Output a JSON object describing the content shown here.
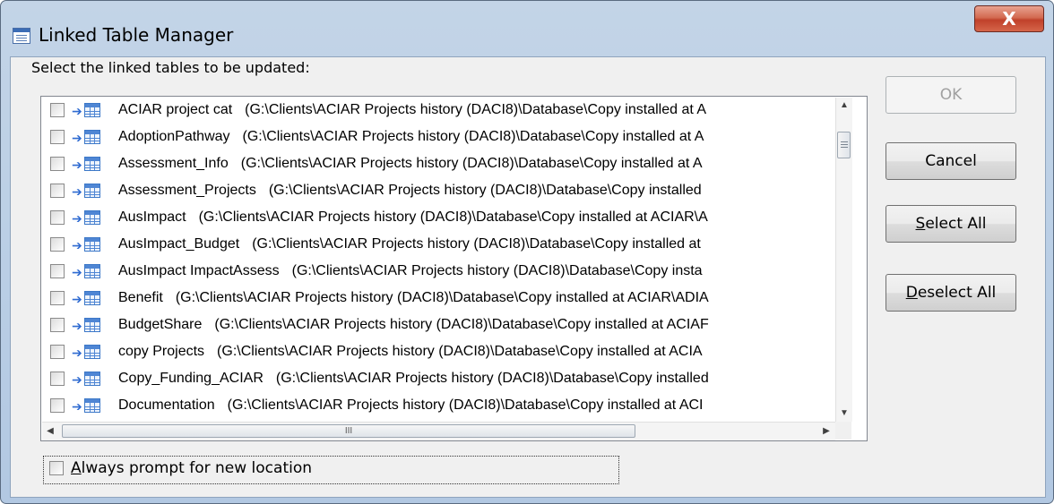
{
  "window": {
    "title": "Linked Table Manager",
    "close_glyph": "X"
  },
  "prompt": "Select the linked tables to be updated:",
  "tables": [
    {
      "name": "ACIAR project cat",
      "path": "(G:\\Clients\\ACIAR Projects history (DACI8)\\Database\\Copy installed at A"
    },
    {
      "name": "AdoptionPathway",
      "path": "(G:\\Clients\\ACIAR Projects history (DACI8)\\Database\\Copy installed at A"
    },
    {
      "name": "Assessment_Info",
      "path": "(G:\\Clients\\ACIAR Projects history (DACI8)\\Database\\Copy installed at A"
    },
    {
      "name": "Assessment_Projects",
      "path": "(G:\\Clients\\ACIAR Projects history (DACI8)\\Database\\Copy installed"
    },
    {
      "name": "AusImpact",
      "path": "(G:\\Clients\\ACIAR Projects history (DACI8)\\Database\\Copy installed at ACIAR\\A"
    },
    {
      "name": "AusImpact_Budget",
      "path": "(G:\\Clients\\ACIAR Projects history (DACI8)\\Database\\Copy installed at"
    },
    {
      "name": "AusImpact ImpactAssess",
      "path": "(G:\\Clients\\ACIAR Projects history (DACI8)\\Database\\Copy insta"
    },
    {
      "name": "Benefit",
      "path": "(G:\\Clients\\ACIAR Projects history (DACI8)\\Database\\Copy installed at ACIAR\\ADIA"
    },
    {
      "name": "BudgetShare",
      "path": "(G:\\Clients\\ACIAR Projects history (DACI8)\\Database\\Copy installed at ACIAF"
    },
    {
      "name": "copy Projects",
      "path": "(G:\\Clients\\ACIAR Projects history (DACI8)\\Database\\Copy installed at ACIA"
    },
    {
      "name": "Copy_Funding_ACIAR",
      "path": "(G:\\Clients\\ACIAR Projects history (DACI8)\\Database\\Copy installed"
    },
    {
      "name": "Documentation",
      "path": "(G:\\Clients\\ACIAR Projects history (DACI8)\\Database\\Copy installed at ACI"
    }
  ],
  "buttons": {
    "ok": "OK",
    "cancel": "Cancel",
    "select_all": "Select All",
    "deselect_all": "Deselect All"
  },
  "always_prompt": "Always prompt for new location",
  "icons": [
    "table-manager-icon",
    "close-icon",
    "link-arrow-icon",
    "linked-table-icon",
    "scroll-up-icon",
    "scroll-down-icon",
    "scroll-left-icon",
    "scroll-right-icon"
  ]
}
